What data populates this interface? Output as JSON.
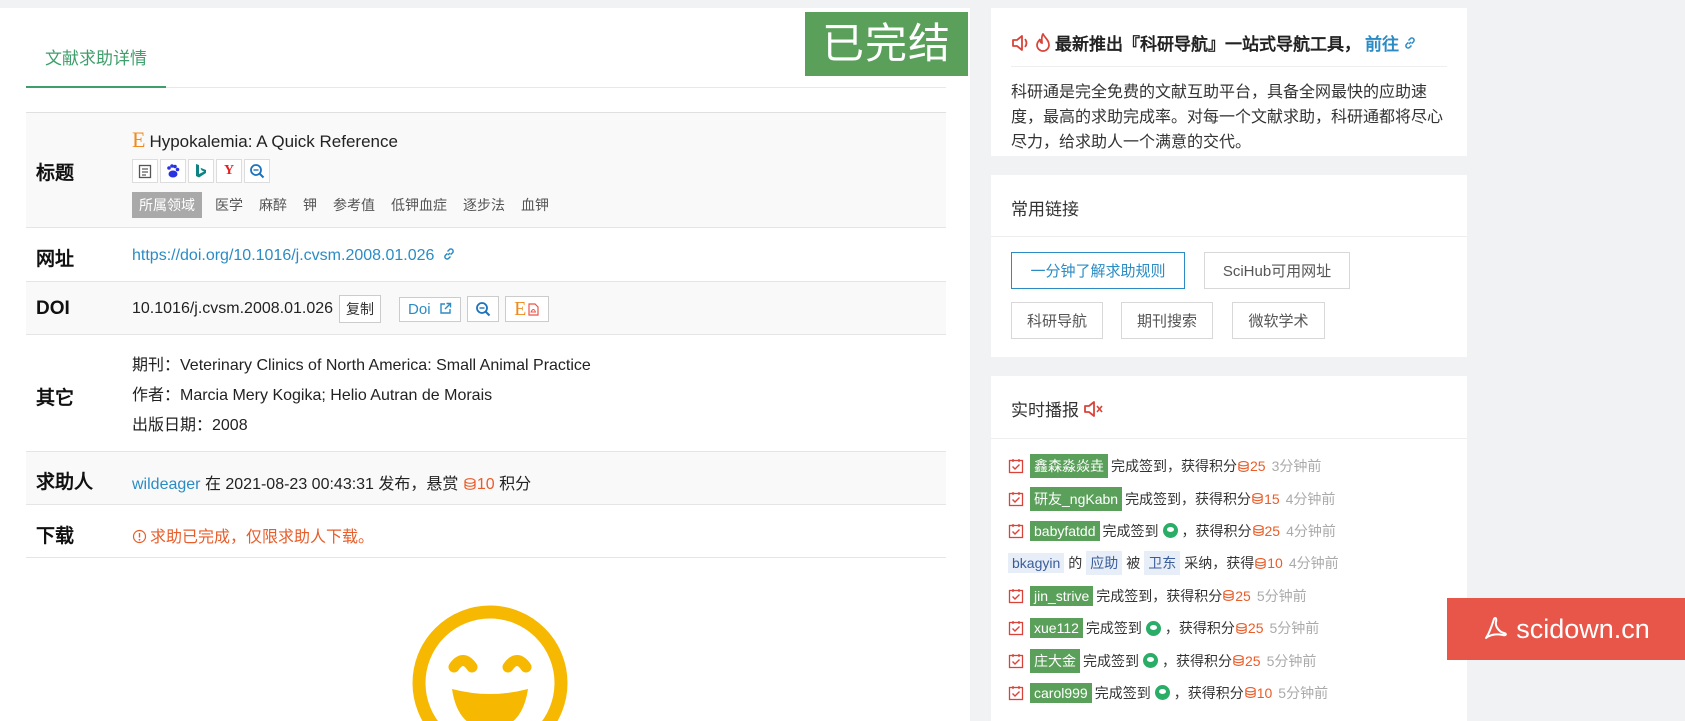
{
  "tab": {
    "label": "文献求助详情"
  },
  "status": {
    "label": "已完结"
  },
  "detail": {
    "title_label": "标题",
    "paper_title": "Hypokalemia: A Quick Reference",
    "e_glyph": "E",
    "icons": [
      "document-icon",
      "baidu-icon",
      "bing-icon",
      "yandex-icon",
      "search-icon"
    ],
    "icon_glyphs": {
      "yandex": "Y"
    },
    "field_tag": "所属领域",
    "tags": [
      "医学",
      "麻醉",
      "钾",
      "参考值",
      "低钾血症",
      "逐步法",
      "血钾"
    ],
    "url_label": "网址",
    "url": "https://doi.org/10.1016/j.cvsm.2008.01.026",
    "doi_label": "DOI",
    "doi": "10.1016/j.cvsm.2008.01.026",
    "copy_label": "复制",
    "doi_btn_label": "Doi",
    "other_label": "其它",
    "journal": "期刊：Veterinary Clinics of North America: Small Animal Practice",
    "authors": "作者：Marcia Mery Kogika; Helio Autran de Morais",
    "pub_date": "出版日期：2008",
    "asker_label": "求助人",
    "asker": "wildeager",
    "asker_text": "在 2021-08-23 00:43:31 发布，悬赏",
    "reward": "10",
    "reward_unit": "积分",
    "download_label": "下载",
    "download_notice": "求助已完成，仅限求助人下载。"
  },
  "announcement": {
    "headline": "最新推出『科研导航』一站式导航工具，",
    "link": "前往",
    "body": "科研通是完全免费的文献互助平台，具备全网最快的应助速度，最高的求助完成率。对每一个文献求助，科研通都将尽心尽力，给求助人一个满意的交代。"
  },
  "links_card": {
    "title": "常用链接",
    "buttons": [
      "一分钟了解求助规则",
      "SciHub可用网址",
      "科研导航",
      "期刊搜索",
      "微软学术"
    ]
  },
  "live_feed": {
    "title": "实时播报",
    "items": [
      {
        "user": "鑫森淼焱垚",
        "action": "完成签到，获得积分",
        "points": "25",
        "time": "3分钟前",
        "wechat": false
      },
      {
        "user": "研友_ngKabn",
        "action": "完成签到，获得积分",
        "points": "15",
        "time": "4分钟前",
        "wechat": false
      },
      {
        "user": "babyfatdd",
        "action_pre": "完成签到",
        "action_post": "，获得积分",
        "points": "25",
        "time": "4分钟前",
        "wechat": true
      },
      {
        "adopt": true,
        "helper": "bkagyin",
        "of": "的",
        "kind": "应助",
        "by": "被",
        "adopter": "卫东",
        "action": "采纳，获得",
        "points": "10",
        "time": "4分钟前"
      },
      {
        "user": "jin_strive",
        "action": "完成签到，获得积分",
        "points": "25",
        "time": "5分钟前",
        "wechat": false
      },
      {
        "user": "xue112",
        "action_pre": "完成签到",
        "action_post": "，获得积分",
        "points": "25",
        "time": "5分钟前",
        "wechat": true
      },
      {
        "user": "庄大金",
        "action_pre": "完成签到",
        "action_post": "，获得积分",
        "points": "25",
        "time": "5分钟前",
        "wechat": true
      },
      {
        "user": "carol999",
        "action_pre": "完成签到",
        "action_post": "，获得积分",
        "points": "10",
        "time": "5分钟前",
        "wechat": true
      }
    ]
  },
  "scidown": {
    "label": "scidown.cn"
  },
  "colors": {
    "accent_green": "#5aa05a",
    "link_blue": "#2b8cc4",
    "orange": "#e85d2a",
    "scidown_red": "#e8564a",
    "smiley_yellow": "#f6b800"
  }
}
